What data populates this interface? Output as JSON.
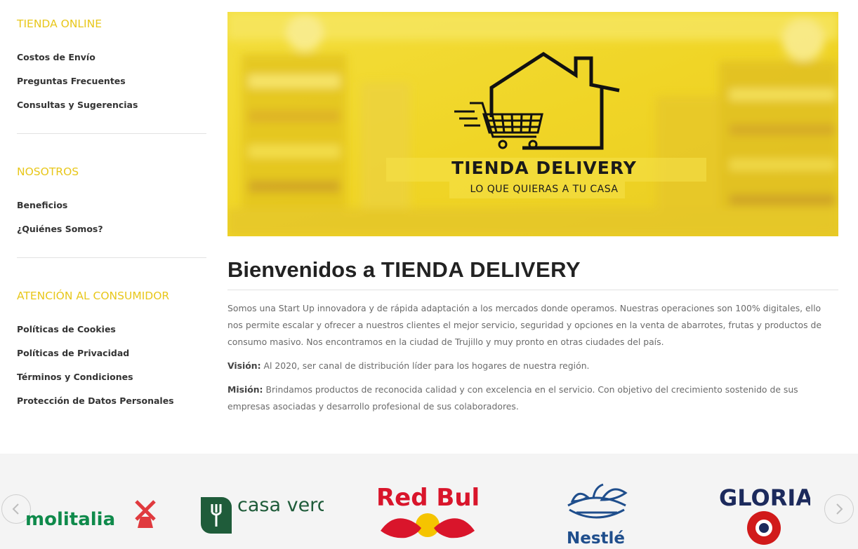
{
  "sidebar": {
    "tienda_online": {
      "title": "TIENDA ONLINE",
      "items": [
        "Costos de Envío",
        "Preguntas Frecuentes",
        "Consultas y Sugerencias"
      ]
    },
    "nosotros": {
      "title": "NOSOTROS",
      "items": [
        "Beneficios",
        "¿Quiénes Somos?"
      ]
    },
    "atencion": {
      "title": "ATENCIÓN AL CONSUMIDOR",
      "items": [
        "Políticas de Cookies",
        "Políticas de Privacidad",
        "Términos y Condiciones",
        "Protección de Datos Personales"
      ]
    }
  },
  "banner": {
    "brand": "TIENDA DELIVERY",
    "tagline": "LO QUE QUIERAS A TU CASA"
  },
  "main": {
    "heading_prefix": "Bienvenidos a",
    "heading_brand": "TIENDA DELIVERY",
    "intro": "Somos una Start Up innovadora y de rápida adaptación a los mercados donde operamos. Nuestras operaciones son 100% digitales, ello nos permite escalar y ofrecer a nuestros clientes el mejor servicio, seguridad y opciones en la venta de abarrotes, frutas y productos de consumo masivo. Nos encontramos en la ciudad de Trujillo y muy pronto en otras ciudades del país.",
    "vision_label": "Visión:",
    "vision_text": "Al 2020, ser canal de distribución líder para los hogares de nuestra región.",
    "mision_label": "Misión:",
    "mision_text": "Brindamos productos de reconocida calidad y con excelencia en el servicio. Con objetivo del crecimiento sostenido de sus empresas asociadas y desarrollo profesional de sus colaboradores."
  },
  "brands": {
    "logos": [
      "molitalia",
      "casa verde",
      "Red Bull",
      "Nestlé",
      "GLORIA"
    ],
    "prev_icon": "chevron-left-icon",
    "next_icon": "chevron-right-icon"
  },
  "colors": {
    "accent": "#e8c71b",
    "banner_yellow": "#f1d726",
    "molitalia_green": "#0f8a4b",
    "molitalia_red": "#e03a3e",
    "casaverde_green": "#1f5c3a",
    "redbull_red": "#d9152b",
    "redbull_gold": "#f5c400",
    "nestle_blue": "#1f4e8c",
    "gloria_navy": "#1c2a5c",
    "gloria_red": "#d11a1a"
  }
}
